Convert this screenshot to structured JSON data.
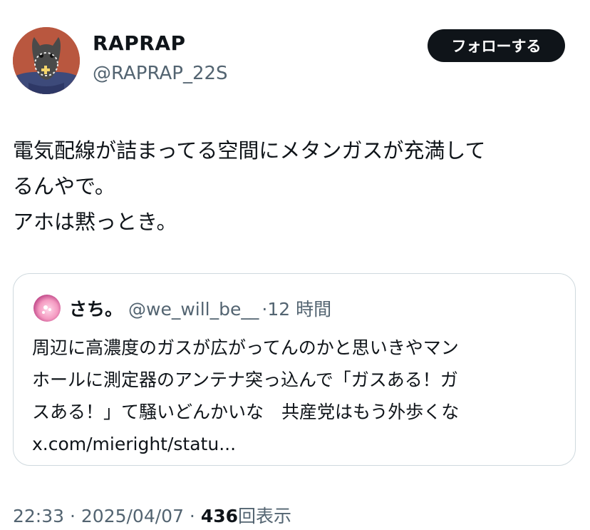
{
  "author": {
    "display_name": "RAPRAP",
    "handle": "@RAPRAP_22S",
    "avatar_icon": "cat-avatar-icon"
  },
  "follow_label": "フォローする",
  "tweet": {
    "lines": [
      "電気配線が詰まってる空間にメタンガスが充満して",
      "るんやで。",
      "アホは黙っとき。"
    ]
  },
  "quote": {
    "display_name": "さち。",
    "handle": "@we_will_be__",
    "time": "·12 時間",
    "lines": [
      "周辺に高濃度のガスが広がってんのかと思いきやマン",
      "ホールに測定器のアンテナ突っ込んで「ガスある！ガ",
      "スある！」て騒いどんかいな　共産党はもう外歩くな",
      "x.com/mieright/statu..."
    ]
  },
  "footer": {
    "time": "22:33",
    "sep1": " · ",
    "date": "2025/04/07",
    "sep2": " · ",
    "views_count": "436",
    "views_label": "回表示"
  },
  "colors": {
    "text": "#0f1419",
    "secondary": "#536471",
    "border": "#cfd9de",
    "button_bg": "#0f1419"
  }
}
